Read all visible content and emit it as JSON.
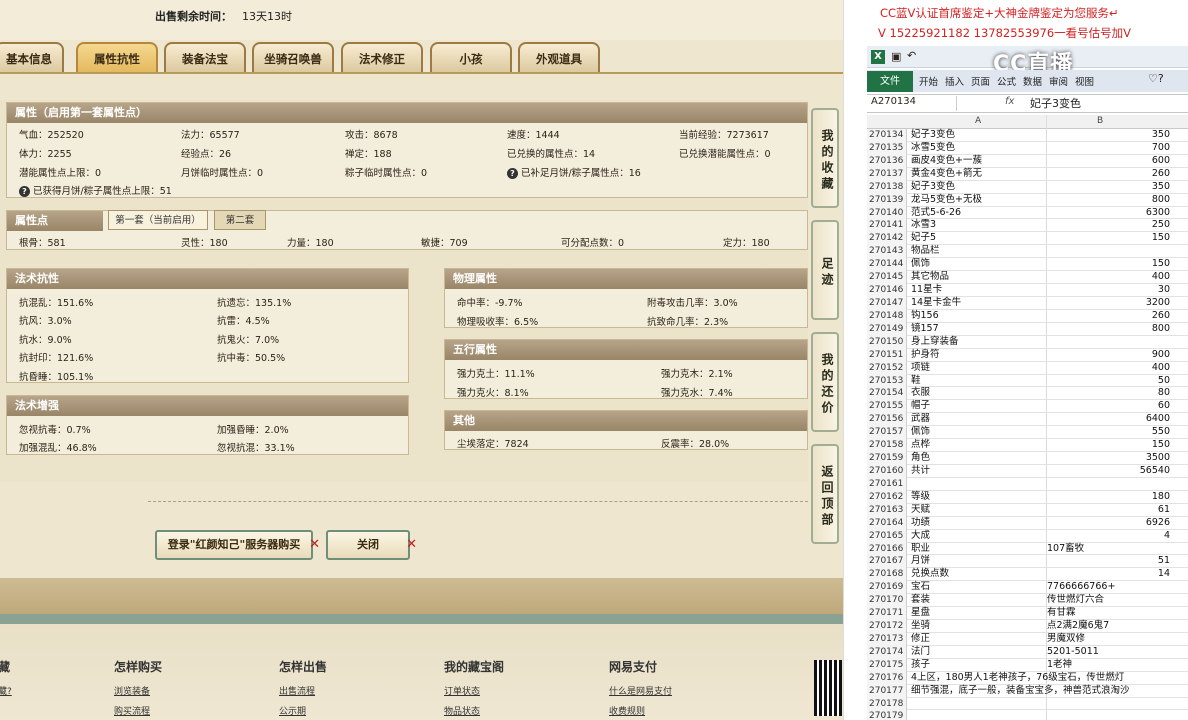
{
  "header": {
    "sale_time_label": "出售剩余时间：",
    "sale_time_value": "13天13时"
  },
  "tabs": [
    "基本信息",
    "属性抗性",
    "装备法宝",
    "坐骑召唤兽",
    "法术修正",
    "小孩",
    "外观道具"
  ],
  "attr": {
    "title": "属性（启用第一套属性点）",
    "r1": [
      "气血：252520",
      "法力：65577",
      "攻击：8678",
      "速度：1444",
      "当前经验：7273617"
    ],
    "r2": [
      "体力：2255",
      "经验点：26",
      "禅定：188",
      "已兑换的属性点：14",
      "已兑换潜能属性点：0"
    ],
    "r3": [
      "潜能属性点上限：0",
      "月饼临时属性点：0",
      "粽子临时属性点：0",
      "已补足月饼/粽子属性点：16"
    ],
    "r4": "已获得月饼/粽子属性点上限：51"
  },
  "points": {
    "title": "属性点",
    "subtab1": "第一套（当前启用）",
    "subtab2": "第二套",
    "values": [
      "根骨：581",
      "灵性：180",
      "力量：180",
      "敏捷：709",
      "可分配点数：0",
      "定力：180"
    ]
  },
  "resist": {
    "title": "法术抗性",
    "items": [
      "抗混乱：151.6%",
      "抗遗忘：135.1%",
      "抗风：3.0%",
      "抗雷：4.5%",
      "抗水：9.0%",
      "抗鬼火：7.0%",
      "抗封印：121.6%",
      "抗中毒：50.5%",
      "抗昏睡：105.1%"
    ]
  },
  "physical": {
    "title": "物理属性",
    "items": [
      "命中率：-9.7%",
      "附毒攻击几率：3.0%",
      "物理吸收率：6.5%",
      "抗致命几率：2.3%"
    ]
  },
  "elements": {
    "title": "五行属性",
    "items": [
      "强力克土：11.1%",
      "强力克木：2.1%",
      "强力克火：8.1%",
      "强力克水：7.4%"
    ]
  },
  "enhance": {
    "title": "法术增强",
    "items": [
      "忽视抗毒：0.7%",
      "加强昏睡：2.0%",
      "加强混乱：46.8%",
      "忽视抗混：33.1%"
    ]
  },
  "other": {
    "title": "其他",
    "items": [
      "尘埃落定：7824",
      "反震率：28.0%"
    ]
  },
  "side_buttons": [
    "我的收藏",
    "足迹",
    "我的还价",
    "返回顶部"
  ],
  "buttons": {
    "login": "登录\"红颜知己\"服务器购买",
    "close": "关闭"
  },
  "footer": {
    "cols": [
      "怎样购买",
      "怎样出售",
      "我的藏宝阁",
      "网易支付"
    ],
    "links": [
      "浏览装备",
      "出售流程",
      "订单状态",
      "什么是网易支付",
      "购买流程",
      "公示期",
      "物品状态",
      "收费规则"
    ],
    "partial_col": "藏",
    "partial_link": "藏?"
  },
  "promo": {
    "line1": "CC蓝V认证首席鉴定+大神金牌鉴定为您服务↵",
    "line2": "V 15225921182     13782553976一看号估号加V"
  },
  "excel": {
    "tabs": [
      "文件",
      "开始",
      "插入",
      "页面",
      "公式",
      "数据",
      "审阅",
      "视图"
    ],
    "namebox": "A270134",
    "fx": "fx",
    "formula": "妃子3变色",
    "col_a": "A",
    "col_b": "B",
    "logo": "CC直播",
    "rows": [
      [
        "270134",
        "妃子3变色",
        "350"
      ],
      [
        "270135",
        "冰雪5变色",
        "700"
      ],
      [
        "270136",
        "画皮4变色+一蔟",
        "600"
      ],
      [
        "270137",
        "黄金4变色+箭无",
        "260"
      ],
      [
        "270138",
        "妃子3变色",
        "350"
      ],
      [
        "270139",
        "龙马5变色+无极",
        "800"
      ],
      [
        "270140",
        "范式5-6-26",
        "6300"
      ],
      [
        "270141",
        "冰雪3",
        "250"
      ],
      [
        "270142",
        "妃子5",
        "150"
      ],
      [
        "270143",
        "物品栏",
        ""
      ],
      [
        "270144",
        "佩饰",
        "150"
      ],
      [
        "270145",
        "其它物品",
        "400"
      ],
      [
        "270146",
        "11星卡",
        "30"
      ],
      [
        "270147",
        "14星卡金牛",
        "3200"
      ],
      [
        "270148",
        "钩156",
        "260"
      ],
      [
        "270149",
        "镜157",
        "800"
      ],
      [
        "270150",
        "身上穿装备",
        ""
      ],
      [
        "270151",
        "护身符",
        "900"
      ],
      [
        "270152",
        "项链",
        "400"
      ],
      [
        "270153",
        "鞋",
        "50"
      ],
      [
        "270154",
        "衣服",
        "80"
      ],
      [
        "270155",
        "帽子",
        "60"
      ],
      [
        "270156",
        "武器",
        "6400"
      ],
      [
        "270157",
        "佩饰",
        "550"
      ],
      [
        "270158",
        "点桦",
        "150"
      ],
      [
        "270159",
        "角色",
        "3500"
      ],
      [
        "270160",
        "共计",
        "56540"
      ],
      [
        "270161",
        "",
        ""
      ],
      [
        "270162",
        "等级",
        "180"
      ],
      [
        "270163",
        "天赋",
        "61"
      ],
      [
        "270164",
        "功绩",
        "6926"
      ],
      [
        "270165",
        "大成",
        "4"
      ],
      [
        "270166",
        "职业",
        "107畜牧"
      ],
      [
        "270167",
        "月饼",
        "51"
      ],
      [
        "270168",
        "兑换点数",
        "14"
      ],
      [
        "270169",
        "宝石",
        "7766666766+"
      ],
      [
        "270170",
        "套装",
        "传世燃灯六合"
      ],
      [
        "270171",
        "星盘",
        "有甘霖"
      ],
      [
        "270172",
        "坐骑",
        "点2满2魔6鬼7"
      ],
      [
        "270173",
        "修正",
        "男魔双修"
      ],
      [
        "270174",
        "法门",
        "5201-5011"
      ],
      [
        "270175",
        "孩子",
        "1老神"
      ],
      [
        "270176",
        "4上区，180男人1老神孩子，76级宝石，传世燃灯",
        ""
      ],
      [
        "270177",
        "细节强混，底子一般，装备宝宝多，神兽范式浪淘沙",
        ""
      ],
      [
        "270178",
        "",
        ""
      ],
      [
        "270179",
        "",
        ""
      ],
      [
        "270180",
        "",
        ""
      ]
    ]
  }
}
